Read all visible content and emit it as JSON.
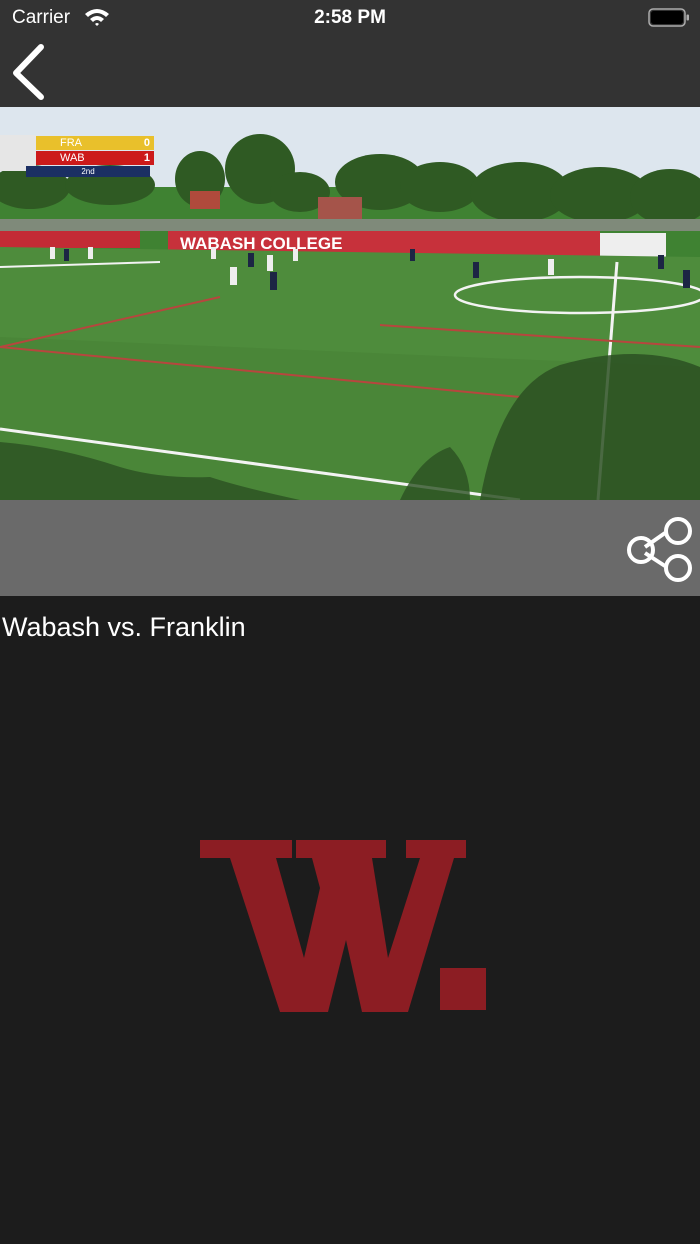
{
  "status_bar": {
    "carrier": "Carrier",
    "time": "2:58 PM",
    "icons": [
      "wifi-icon",
      "battery-icon"
    ]
  },
  "nav_bar": {
    "back_icon": "chevron-left-icon"
  },
  "video": {
    "banner_text": "WABASH COLLEGE",
    "scorebug": {
      "home_team": "FRA",
      "home_score": "0",
      "away_team": "WAB",
      "away_score": "1",
      "period": "2nd"
    }
  },
  "actions": {
    "share_icon": "share-icon"
  },
  "title": "Wabash vs. Franklin",
  "logo": {
    "text": "W.",
    "color": "#8c1d23"
  },
  "colors": {
    "bar_background": "#333333",
    "body_background": "#1c1c1c",
    "action_bar": "#6a6a6a",
    "brand_red": "#8c1d23"
  }
}
